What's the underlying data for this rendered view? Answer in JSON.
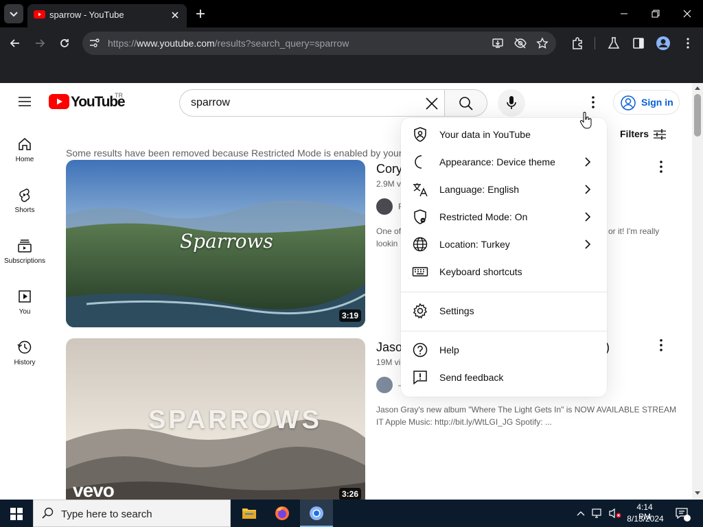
{
  "browser": {
    "tab_title": "sparrow - YouTube",
    "url_prefix": "https://",
    "url_host": "www.youtube.com",
    "url_path": "/results?search_query=sparrow"
  },
  "youtube": {
    "logo_text": "YouTube",
    "region_code": "TR",
    "search_value": "sparrow",
    "signin_label": "Sign in",
    "filters_label": "Filters",
    "restricted_notice": "Some results have been removed because Restricted Mode is enabled by your r",
    "nav": [
      {
        "label": "Home"
      },
      {
        "label": "Shorts"
      },
      {
        "label": "Subscriptions"
      },
      {
        "label": "You"
      },
      {
        "label": "History"
      }
    ],
    "videos": [
      {
        "title": "Cory",
        "meta": "2.9M vi",
        "channel_initial": "F",
        "desc_line1": "One of",
        "desc_line1_right": "or it! I'm really",
        "desc_line2": "lookin",
        "thumb_text": "Sparrows",
        "duration": "3:19"
      },
      {
        "title": "Jaso",
        "title_tail": ")",
        "meta": "19M vi",
        "channel_initial": "–",
        "desc_line1": "Jason Gray's new album \"Where The Light Gets In\" is NOW AVAILABLE STREAM",
        "desc_line2": "IT Apple Music: http://bit.ly/WtLGI_JG Spotify: ...",
        "thumb_text": "SPARROWS",
        "thumb_brand": "vevo",
        "duration": "3:26"
      }
    ]
  },
  "menu": {
    "items": [
      {
        "label": "Your data in YouTube",
        "icon": "shield-person-icon",
        "has_submenu": false
      },
      {
        "label": "Appearance: Device theme",
        "icon": "moon-icon",
        "has_submenu": true
      },
      {
        "label": "Language: English",
        "icon": "translate-icon",
        "has_submenu": true
      },
      {
        "label": "Restricted Mode: On",
        "icon": "restricted-icon",
        "has_submenu": true
      },
      {
        "label": "Location: Turkey",
        "icon": "globe-icon",
        "has_submenu": true
      },
      {
        "label": "Keyboard shortcuts",
        "icon": "keyboard-icon",
        "has_submenu": false
      },
      {
        "label": "Settings",
        "icon": "gear-icon",
        "has_submenu": false
      },
      {
        "label": "Help",
        "icon": "help-icon",
        "has_submenu": false
      },
      {
        "label": "Send feedback",
        "icon": "feedback-icon",
        "has_submenu": false
      }
    ]
  },
  "taskbar": {
    "search_placeholder": "Type here to search",
    "time": "4:14 PM",
    "date": "8/13/2024"
  },
  "colors": {
    "youtube_red": "#ff0000",
    "link_blue": "#065fd4",
    "taskbar_bg": "#0c1b2c"
  }
}
